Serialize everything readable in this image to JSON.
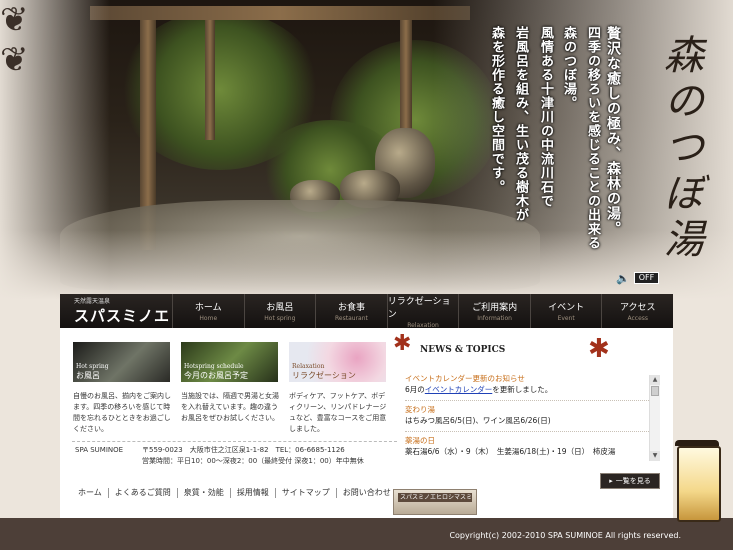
{
  "hero": {
    "vertical_lines": [
      "贅沢な癒しの極み、森林の湯。",
      "四季の移ろいを感じることの出来る",
      "森のつぼ湯。",
      "風情ある十津川の中流川石で",
      "岩風呂を組み、生い茂る樹木が",
      "森を形作る癒し空間です。"
    ],
    "logo_text": "森のつぼ湯",
    "sound_icon": "speaker-icon",
    "sound_label": "OFF"
  },
  "nav": {
    "brand_small": "天然露天温泉",
    "brand_big": "スパスミノエ",
    "items": [
      {
        "jp": "ホーム",
        "en": "Home"
      },
      {
        "jp": "お風呂",
        "en": "Hot spring"
      },
      {
        "jp": "お食事",
        "en": "Restaurant"
      },
      {
        "jp": "リラクゼーション",
        "en": "Relaxation"
      },
      {
        "jp": "ご利用案内",
        "en": "Information"
      },
      {
        "jp": "イベント",
        "en": "Event"
      },
      {
        "jp": "アクセス",
        "en": "Access"
      }
    ]
  },
  "categories": [
    {
      "en": "Hot spring",
      "jp": "お風呂",
      "desc": "自慢のお風呂、揃内をご案内します。四季の移ろいを感じて時間を忘れるひとときをお過ごしください。"
    },
    {
      "en": "Hotspring schedule",
      "jp": "今月のお風呂予定",
      "desc": "当施設では、隔週で男湯と女湯を入れ替えています。趣の違うお風呂をぜひお試しください。"
    },
    {
      "en": "Relaxation",
      "jp": "リラクゼーション",
      "desc": "ボディケア、フットケア、ボディクリーン、リンパドレナージュなど、豊富なコースをご用意しました。"
    }
  ],
  "info": {
    "name": "SPA SUMINOE",
    "address": "〒559-0023　大阪市住之江区泉1-1-82　TEL：06-6685-1126",
    "hours": "営業時間：平日10：00～深夜2：00（最終受付 深夜1：00）年中無休"
  },
  "footer_links": [
    "ホーム",
    "よくあるご質問",
    "泉質・効能",
    "採用情報",
    "サイトマップ",
    "お問い合わせ"
  ],
  "banner_text": "スパスミノエヒロシマスミノエ",
  "news": {
    "heading": "NEWS & TOPICS",
    "items": [
      {
        "title": "イベントカレンダー更新のお知らせ",
        "before": "6月の",
        "link": "イベントカレンダー",
        "after": "を更新しました。"
      },
      {
        "title": "変わり湯",
        "body": "はちみつ風呂6/5(日)、ワイン風呂6/26(日)"
      },
      {
        "title": "薬湯の日",
        "body": "薬石湯6/6（水）・9（木）　生姜湯6/18(土)・19（日）　柿皮湯"
      }
    ],
    "more_label": "一覧を見る"
  },
  "copyright": "Copyright(c) 2002-2010 SPA SUMINOE All rights reserved."
}
